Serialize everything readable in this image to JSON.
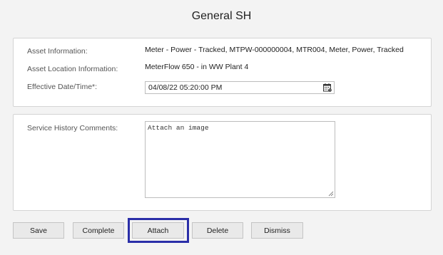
{
  "page": {
    "title": "General SH"
  },
  "asset_panel": {
    "asset_info_label": "Asset Information:",
    "asset_info_value": "Meter - Power - Tracked, MTPW-000000004, MTR004, Meter, Power, Tracked",
    "location_label": "Asset Location Information:",
    "location_value": "MeterFlow 650 - in WW Plant 4",
    "date_label": "Effective Date/Time*:",
    "date_value": "04/08/22 05:20:00 PM",
    "calendar_icon": "calendar-icon"
  },
  "comments_panel": {
    "label": "Service History Comments:",
    "value": "Attach an image"
  },
  "buttons": {
    "save": "Save",
    "complete": "Complete",
    "attach": "Attach",
    "delete": "Delete",
    "dismiss": "Dismiss"
  },
  "colors": {
    "highlight_border": "#2a2ea8",
    "button_bg": "#e9e9e9",
    "page_bg": "#f3f3f3"
  }
}
